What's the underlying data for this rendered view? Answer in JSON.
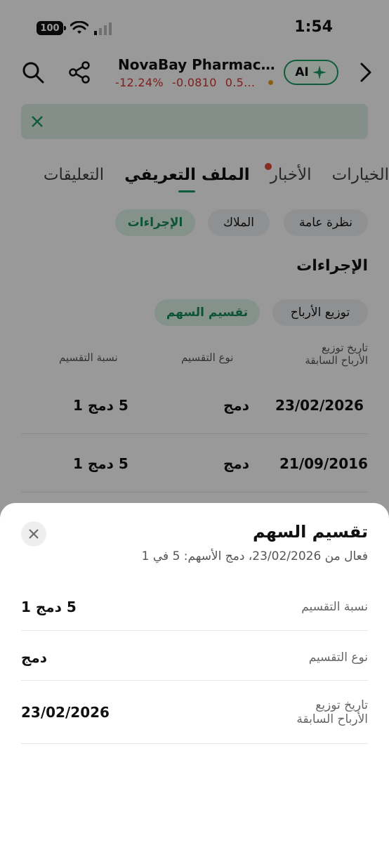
{
  "status_bar": {
    "time": "1:54",
    "battery": "100"
  },
  "header": {
    "title": "NovaBay Pharmac...",
    "change_percent": "-12.24%",
    "change_value": "-0.0810",
    "price": "0.5...",
    "ai_label": "AI"
  },
  "tabs": [
    "الخيارات",
    "الأخبار",
    "الملف التعريفي",
    "التعليقات"
  ],
  "subtabs": [
    "نظرة عامة",
    "الملاك",
    "الإجراءات"
  ],
  "section_title": "الإجراءات",
  "action_chips": [
    "توزيع الأرباح",
    "تقسيم السهم"
  ],
  "table": {
    "headers": [
      "تاريخ توزيع\nالأرباح السابقة",
      "نوع التقسيم",
      "نسبة التقسيم"
    ],
    "rows": [
      {
        "date": "23/02/2026",
        "type": "دمج",
        "ratio": "5 دمج 1"
      },
      {
        "date": "21/09/2016",
        "type": "دمج",
        "ratio": "5 دمج 1"
      }
    ]
  },
  "sheet": {
    "title": "تقسيم السهم",
    "subtitle": "فعال من 23/02/2026، دمج الأسهم: 5 في 1",
    "items": [
      {
        "label": "نسبة التقسيم",
        "value": "5 دمج 1"
      },
      {
        "label": "نوع التقسيم",
        "value": "دمج"
      },
      {
        "label": "تاريخ توزيع\nالأرباح السابقة",
        "value": "23/02/2026"
      }
    ]
  },
  "colors": {
    "accent": "#1a9a66",
    "negative": "#d6322f",
    "badge": "#e24a37"
  }
}
